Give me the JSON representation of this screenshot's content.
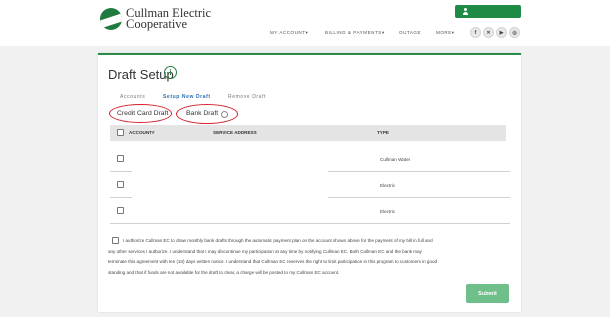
{
  "header": {
    "logo_text_line1": "Cullman Electric",
    "logo_text_line2": "Cooperative",
    "nav": [
      "MY ACCOUNT▾",
      "BILLING & PAYMENTS▾",
      "OUTAGE",
      "MORE▾"
    ],
    "social": [
      "f",
      "✕",
      "▶",
      "◎"
    ]
  },
  "page": {
    "title": "Draft Setup",
    "info_glyph": "i",
    "tabs": [
      "Accounts",
      "Setup New Draft",
      "Remove Draft"
    ],
    "draft_types": [
      "Credit Card Draft",
      "Bank Draft"
    ]
  },
  "table": {
    "headers": [
      "ACCOUNT#",
      "SERVICE ADDRESS",
      "TYPE"
    ],
    "rows": [
      {
        "account": "",
        "address": "",
        "type": "Cullman Water"
      },
      {
        "account": "",
        "address": "",
        "type": "Electric"
      },
      {
        "account": "",
        "address": "",
        "type": "Electric"
      }
    ]
  },
  "authorization": {
    "line1": "I authorize Cullman EC to draw monthly bank drafts through the automatic payment plan on the account shown above for the payment of my bill in full and",
    "line2": "any other services I authorize. I understand that I may discontinue my participation at any time by notifying Cullman EC. Both Cullman EC and the bank may",
    "line3": "terminate this agreement with ten (10) days written notice. I understand that Cullman EC reserves the right to limit participation in this program to customers in good",
    "line4": "standing and that if funds are not available for the draft to clear, a charge will be posted to my Cullman EC account."
  },
  "actions": {
    "submit_label": "Submit"
  },
  "colors": {
    "brand_green": "#1f8a46",
    "accent_green": "#2b8a4a",
    "submit_green": "#6fbf8b",
    "active_tab": "#2a6fb5",
    "annotation_red": "#d5232f"
  }
}
